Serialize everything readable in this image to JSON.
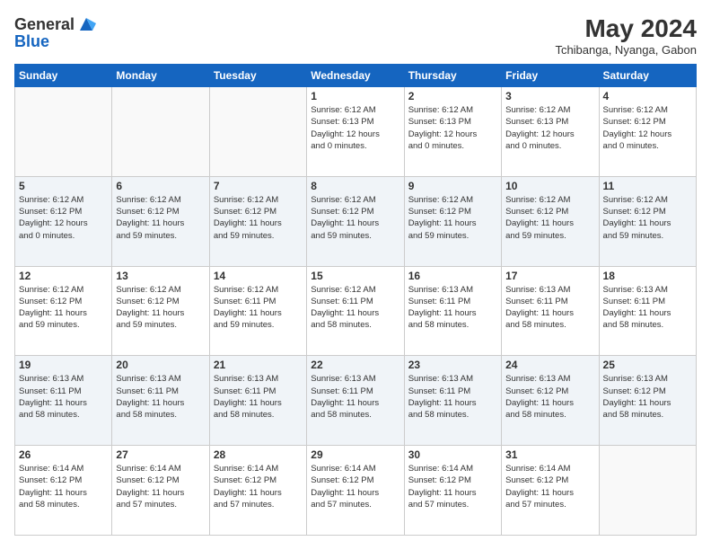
{
  "logo": {
    "line1": "General",
    "line2": "Blue"
  },
  "header": {
    "month_year": "May 2024",
    "location": "Tchibanga, Nyanga, Gabon"
  },
  "weekdays": [
    "Sunday",
    "Monday",
    "Tuesday",
    "Wednesday",
    "Thursday",
    "Friday",
    "Saturday"
  ],
  "weeks": [
    [
      {
        "day": "",
        "info": ""
      },
      {
        "day": "",
        "info": ""
      },
      {
        "day": "",
        "info": ""
      },
      {
        "day": "1",
        "info": "Sunrise: 6:12 AM\nSunset: 6:13 PM\nDaylight: 12 hours\nand 0 minutes."
      },
      {
        "day": "2",
        "info": "Sunrise: 6:12 AM\nSunset: 6:13 PM\nDaylight: 12 hours\nand 0 minutes."
      },
      {
        "day": "3",
        "info": "Sunrise: 6:12 AM\nSunset: 6:13 PM\nDaylight: 12 hours\nand 0 minutes."
      },
      {
        "day": "4",
        "info": "Sunrise: 6:12 AM\nSunset: 6:12 PM\nDaylight: 12 hours\nand 0 minutes."
      }
    ],
    [
      {
        "day": "5",
        "info": "Sunrise: 6:12 AM\nSunset: 6:12 PM\nDaylight: 12 hours\nand 0 minutes."
      },
      {
        "day": "6",
        "info": "Sunrise: 6:12 AM\nSunset: 6:12 PM\nDaylight: 11 hours\nand 59 minutes."
      },
      {
        "day": "7",
        "info": "Sunrise: 6:12 AM\nSunset: 6:12 PM\nDaylight: 11 hours\nand 59 minutes."
      },
      {
        "day": "8",
        "info": "Sunrise: 6:12 AM\nSunset: 6:12 PM\nDaylight: 11 hours\nand 59 minutes."
      },
      {
        "day": "9",
        "info": "Sunrise: 6:12 AM\nSunset: 6:12 PM\nDaylight: 11 hours\nand 59 minutes."
      },
      {
        "day": "10",
        "info": "Sunrise: 6:12 AM\nSunset: 6:12 PM\nDaylight: 11 hours\nand 59 minutes."
      },
      {
        "day": "11",
        "info": "Sunrise: 6:12 AM\nSunset: 6:12 PM\nDaylight: 11 hours\nand 59 minutes."
      }
    ],
    [
      {
        "day": "12",
        "info": "Sunrise: 6:12 AM\nSunset: 6:12 PM\nDaylight: 11 hours\nand 59 minutes."
      },
      {
        "day": "13",
        "info": "Sunrise: 6:12 AM\nSunset: 6:12 PM\nDaylight: 11 hours\nand 59 minutes."
      },
      {
        "day": "14",
        "info": "Sunrise: 6:12 AM\nSunset: 6:11 PM\nDaylight: 11 hours\nand 59 minutes."
      },
      {
        "day": "15",
        "info": "Sunrise: 6:12 AM\nSunset: 6:11 PM\nDaylight: 11 hours\nand 58 minutes."
      },
      {
        "day": "16",
        "info": "Sunrise: 6:13 AM\nSunset: 6:11 PM\nDaylight: 11 hours\nand 58 minutes."
      },
      {
        "day": "17",
        "info": "Sunrise: 6:13 AM\nSunset: 6:11 PM\nDaylight: 11 hours\nand 58 minutes."
      },
      {
        "day": "18",
        "info": "Sunrise: 6:13 AM\nSunset: 6:11 PM\nDaylight: 11 hours\nand 58 minutes."
      }
    ],
    [
      {
        "day": "19",
        "info": "Sunrise: 6:13 AM\nSunset: 6:11 PM\nDaylight: 11 hours\nand 58 minutes."
      },
      {
        "day": "20",
        "info": "Sunrise: 6:13 AM\nSunset: 6:11 PM\nDaylight: 11 hours\nand 58 minutes."
      },
      {
        "day": "21",
        "info": "Sunrise: 6:13 AM\nSunset: 6:11 PM\nDaylight: 11 hours\nand 58 minutes."
      },
      {
        "day": "22",
        "info": "Sunrise: 6:13 AM\nSunset: 6:11 PM\nDaylight: 11 hours\nand 58 minutes."
      },
      {
        "day": "23",
        "info": "Sunrise: 6:13 AM\nSunset: 6:11 PM\nDaylight: 11 hours\nand 58 minutes."
      },
      {
        "day": "24",
        "info": "Sunrise: 6:13 AM\nSunset: 6:12 PM\nDaylight: 11 hours\nand 58 minutes."
      },
      {
        "day": "25",
        "info": "Sunrise: 6:13 AM\nSunset: 6:12 PM\nDaylight: 11 hours\nand 58 minutes."
      }
    ],
    [
      {
        "day": "26",
        "info": "Sunrise: 6:14 AM\nSunset: 6:12 PM\nDaylight: 11 hours\nand 58 minutes."
      },
      {
        "day": "27",
        "info": "Sunrise: 6:14 AM\nSunset: 6:12 PM\nDaylight: 11 hours\nand 57 minutes."
      },
      {
        "day": "28",
        "info": "Sunrise: 6:14 AM\nSunset: 6:12 PM\nDaylight: 11 hours\nand 57 minutes."
      },
      {
        "day": "29",
        "info": "Sunrise: 6:14 AM\nSunset: 6:12 PM\nDaylight: 11 hours\nand 57 minutes."
      },
      {
        "day": "30",
        "info": "Sunrise: 6:14 AM\nSunset: 6:12 PM\nDaylight: 11 hours\nand 57 minutes."
      },
      {
        "day": "31",
        "info": "Sunrise: 6:14 AM\nSunset: 6:12 PM\nDaylight: 11 hours\nand 57 minutes."
      },
      {
        "day": "",
        "info": ""
      }
    ]
  ]
}
